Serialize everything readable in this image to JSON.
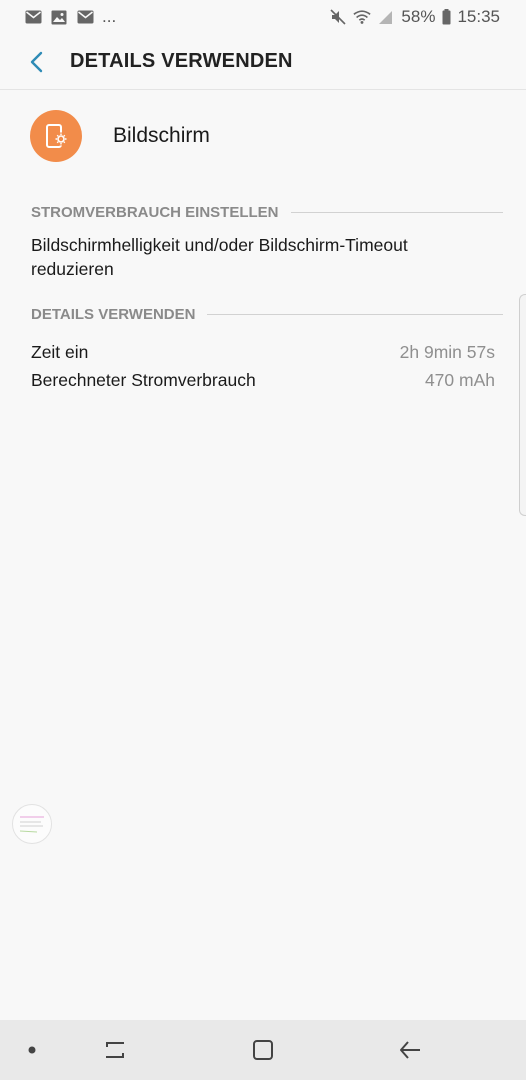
{
  "status_bar": {
    "left_icons": [
      "mail-icon",
      "image-icon",
      "mail-icon"
    ],
    "overflow": "...",
    "right_icons": [
      "mute-icon",
      "wifi-icon",
      "signal-icon"
    ],
    "battery_percent": "58%",
    "time": "15:35"
  },
  "app_bar": {
    "title": "DETAILS VERWENDEN",
    "accent_color": "#2e8bb6"
  },
  "app": {
    "name": "Bildschirm",
    "icon": "screen-settings-icon",
    "icon_color": "#f28c4a"
  },
  "sections": {
    "power": {
      "header": "STROMVERBRAUCH EINSTELLEN",
      "text": "Bildschirmhelligkeit und/oder Bildschirm-Timeout reduzieren"
    },
    "details": {
      "header": "DETAILS VERWENDEN",
      "rows": [
        {
          "label": "Zeit ein",
          "value": "2h 9min 57s"
        },
        {
          "label": "Berechneter Stromverbrauch",
          "value": "470 mAh"
        }
      ]
    }
  },
  "nav_bar": {
    "buttons": [
      "dot-icon",
      "recent-apps-icon",
      "home-icon",
      "back-icon"
    ]
  }
}
